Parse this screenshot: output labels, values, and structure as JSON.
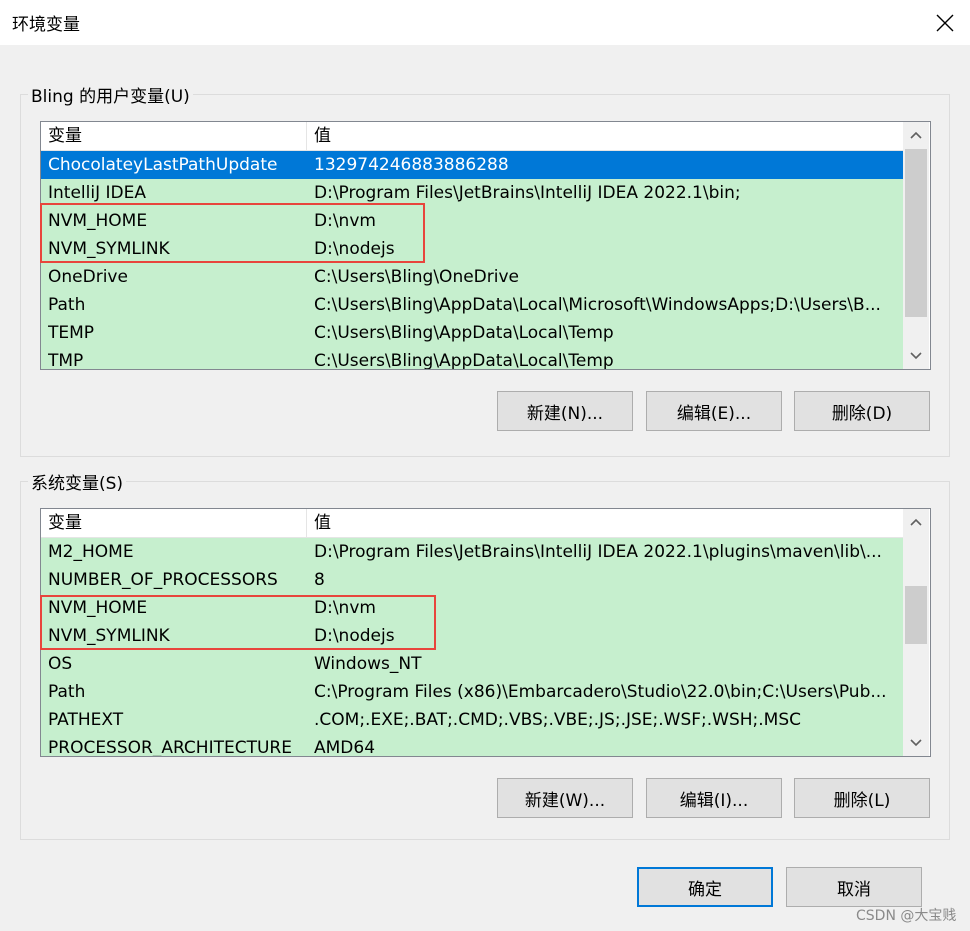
{
  "window": {
    "title": "环境变量",
    "close_icon": "close-icon"
  },
  "user_vars": {
    "group_label": "Bling 的用户变量(U)",
    "col_name": "变量",
    "col_value": "值",
    "rows": [
      {
        "name": "ChocolateyLastPathUpdate",
        "value": "132974246883886288"
      },
      {
        "name": "IntelliJ IDEA",
        "value": "D:\\Program Files\\JetBrains\\IntelliJ IDEA 2022.1\\bin;"
      },
      {
        "name": "NVM_HOME",
        "value": "D:\\nvm"
      },
      {
        "name": "NVM_SYMLINK",
        "value": "D:\\nodejs"
      },
      {
        "name": "OneDrive",
        "value": "C:\\Users\\Bling\\OneDrive"
      },
      {
        "name": "Path",
        "value": "C:\\Users\\Bling\\AppData\\Local\\Microsoft\\WindowsApps;D:\\Users\\B..."
      },
      {
        "name": "TEMP",
        "value": "C:\\Users\\Bling\\AppData\\Local\\Temp"
      },
      {
        "name": "TMP",
        "value": "C:\\Users\\Bling\\AppData\\Local\\Temp"
      }
    ],
    "buttons": {
      "new": "新建(N)...",
      "edit": "编辑(E)...",
      "delete": "删除(D)"
    }
  },
  "system_vars": {
    "group_label": "系统变量(S)",
    "col_name": "变量",
    "col_value": "值",
    "rows": [
      {
        "name": "M2_HOME",
        "value": "D:\\Program Files\\JetBrains\\IntelliJ IDEA 2022.1\\plugins\\maven\\lib\\..."
      },
      {
        "name": "NUMBER_OF_PROCESSORS",
        "value": "8"
      },
      {
        "name": "NVM_HOME",
        "value": "D:\\nvm"
      },
      {
        "name": "NVM_SYMLINK",
        "value": "D:\\nodejs"
      },
      {
        "name": "OS",
        "value": "Windows_NT"
      },
      {
        "name": "Path",
        "value": "C:\\Program Files (x86)\\Embarcadero\\Studio\\22.0\\bin;C:\\Users\\Pub..."
      },
      {
        "name": "PATHEXT",
        "value": ".COM;.EXE;.BAT;.CMD;.VBS;.VBE;.JS;.JSE;.WSF;.WSH;.MSC"
      },
      {
        "name": "PROCESSOR_ARCHITECTURE",
        "value": "AMD64"
      }
    ],
    "buttons": {
      "new": "新建(W)...",
      "edit": "编辑(I)...",
      "delete": "删除(L)"
    }
  },
  "footer": {
    "ok": "确定",
    "cancel": "取消"
  },
  "watermark": "CSDN @大宝贱",
  "colors": {
    "row_highlight": "#c6efce",
    "selected_row": "#0078d7",
    "annotation_box": "#e8453c",
    "default_button_border": "#0078d7"
  }
}
